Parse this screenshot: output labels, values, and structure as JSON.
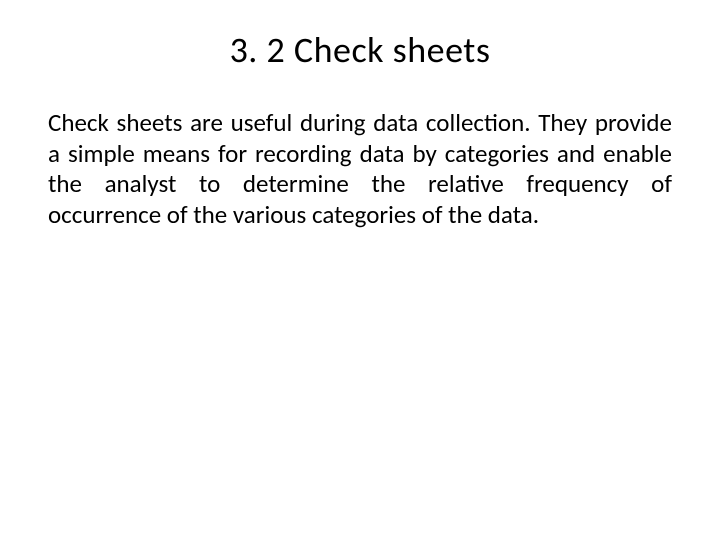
{
  "slide": {
    "title": "3. 2 Check sheets",
    "body": "Check sheets are useful during data collection. They provide a simple means for recording data by categories and enable the analyst to determine the relative frequency of occurrence of the various categories of the data."
  }
}
